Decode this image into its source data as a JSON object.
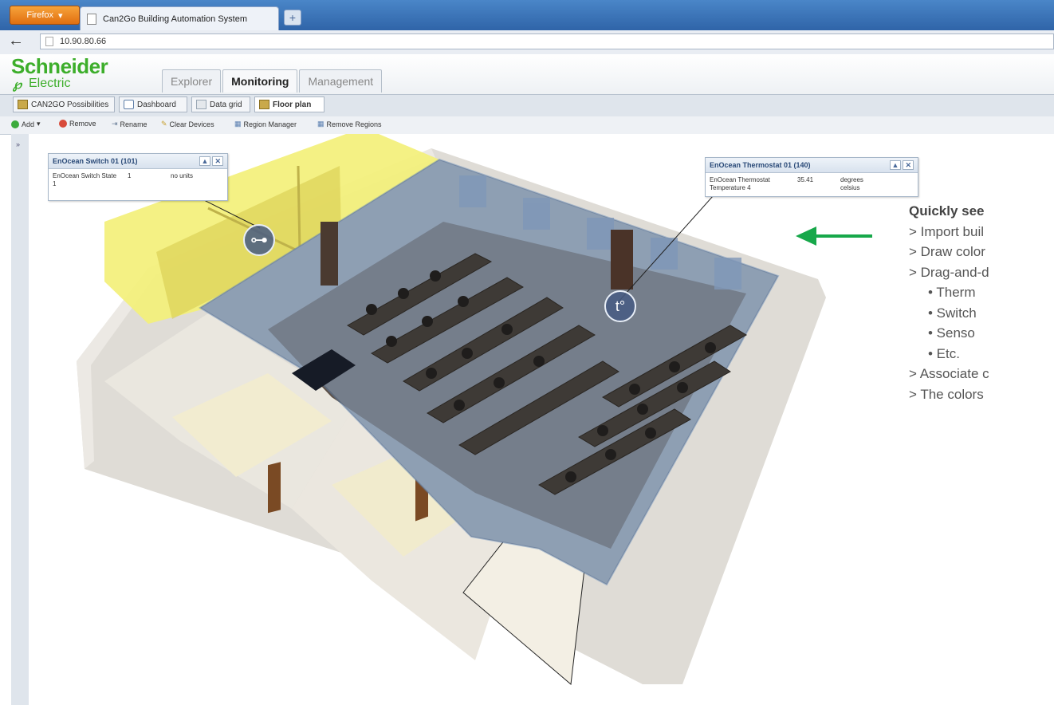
{
  "browser": {
    "app_button": "Firefox",
    "tab_title": "Can2Go Building Automation System",
    "new_tab": "+",
    "url": "10.90.80.66"
  },
  "header": {
    "logo_brand": "Schneider",
    "logo_sub": "Electric",
    "tabs": [
      {
        "label": "Explorer",
        "active": false
      },
      {
        "label": "Monitoring",
        "active": true
      },
      {
        "label": "Management",
        "active": false
      }
    ]
  },
  "subtabs": [
    {
      "label": "CAN2GO Possibilities",
      "icon": "folder-icon"
    },
    {
      "label": "Dashboard",
      "icon": "dashboard-icon"
    },
    {
      "label": "Data grid",
      "icon": "grid-icon"
    },
    {
      "label": "Floor plan",
      "icon": "floorplan-icon",
      "active": true
    }
  ],
  "toolbar": {
    "items": [
      {
        "label": "Add",
        "icon": "add-icon",
        "color": "#3cab3c"
      },
      {
        "label": "Remove",
        "icon": "remove-icon",
        "color": "#d84a3a"
      },
      {
        "label": "Rename",
        "icon": "rename-icon",
        "color": "#6a7f99"
      },
      {
        "label": "Clear Devices",
        "icon": "clear-icon",
        "color": "#c8a030"
      },
      {
        "label": "Region Manager",
        "icon": "region-icon",
        "color": "#5a7fb0"
      },
      {
        "label": "Remove Regions",
        "icon": "remove-regions-icon",
        "color": "#5a7fb0"
      }
    ]
  },
  "panels": {
    "switch": {
      "title": "EnOcean Switch 01 (101)",
      "name": "EnOcean Switch State 1",
      "value": "1",
      "unit": "no units"
    },
    "thermostat": {
      "title": "EnOcean Thermostat 01 (140)",
      "name": "EnOcean Thermostat Temperature 4",
      "value": "35.41",
      "unit": "degrees celsius"
    }
  },
  "devices": {
    "switch_glyph": "⊶",
    "thermo_glyph": "t°"
  },
  "info": {
    "heading": "Quickly see",
    "lines": [
      "> Import buil",
      "> Draw color",
      "> Drag-and-d"
    ],
    "subitems": [
      "• Therm",
      "• Switch",
      "• Senso",
      "• Etc."
    ],
    "tail": [
      "> Associate c",
      "> The colors"
    ]
  },
  "colors": {
    "highlight_yellow": "#f3f07a",
    "highlight_blue": "#93b6dd",
    "arrow_green": "#17a84a",
    "brand_green": "#3dae2b"
  }
}
